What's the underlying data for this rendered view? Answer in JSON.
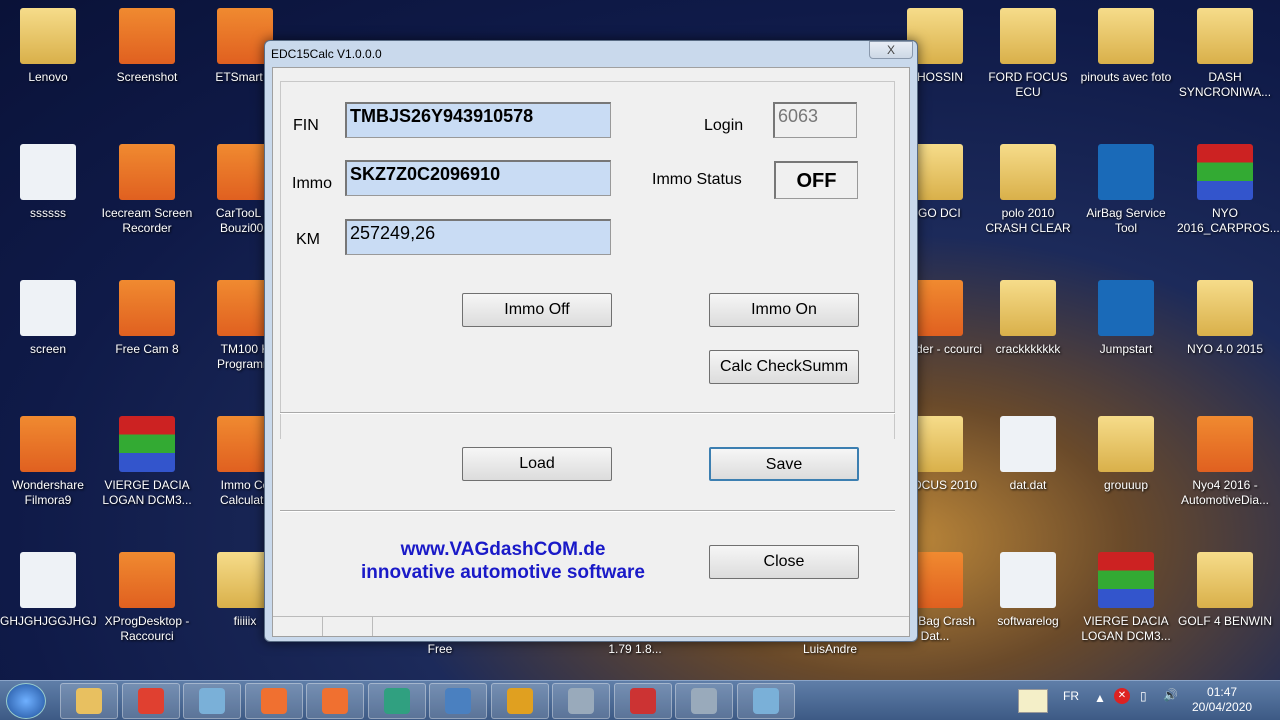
{
  "desktop": {
    "icons": [
      {
        "label": "Lenovo",
        "col": 0,
        "row": 0,
        "kind": "folder"
      },
      {
        "label": "ssssss",
        "col": 0,
        "row": 1,
        "kind": "file"
      },
      {
        "label": "screen",
        "col": 0,
        "row": 2,
        "kind": "file"
      },
      {
        "label": "Wondershare Filmora9",
        "col": 0,
        "row": 3,
        "kind": "app"
      },
      {
        "label": "GHJGHJGGJHGJ",
        "col": 0,
        "row": 4,
        "kind": "file"
      },
      {
        "label": "Screenshot",
        "col": 1,
        "row": 0,
        "kind": "app"
      },
      {
        "label": "Icecream Screen Recorder",
        "col": 1,
        "row": 1,
        "kind": "app"
      },
      {
        "label": "Free Cam 8",
        "col": 1,
        "row": 2,
        "kind": "app"
      },
      {
        "label": "VIERGE DACIA LOGAN DCM3...",
        "col": 1,
        "row": 3,
        "kind": "rar"
      },
      {
        "label": "XProgDesktop - Raccourci",
        "col": 1,
        "row": 4,
        "kind": "app"
      },
      {
        "label": "ETSmart U",
        "col": 2,
        "row": 0,
        "kind": "app"
      },
      {
        "label": "CarTooL 3. Bouzi002",
        "col": 2,
        "row": 1,
        "kind": "app"
      },
      {
        "label": "TM100 K Programm",
        "col": 2,
        "row": 2,
        "kind": "app"
      },
      {
        "label": "Immo Co Calculate",
        "col": 2,
        "row": 3,
        "kind": "app"
      },
      {
        "label": "fiiiiix",
        "col": 2,
        "row": 4,
        "kind": "folder"
      },
      {
        "label": "4 HOSSIN",
        "col": 3,
        "row": 0,
        "kind": "folder"
      },
      {
        "label": "NGO DCI",
        "col": 3,
        "row": 1,
        "kind": "folder"
      },
      {
        "label": "SLoader - ccourci",
        "col": 3,
        "row": 2,
        "kind": "app"
      },
      {
        "label": "D FOCUS 2010",
        "col": 3,
        "row": 3,
        "kind": "folder"
      },
      {
        "label": "s AirBag Crash Dat...",
        "col": 3,
        "row": 4,
        "kind": "app"
      },
      {
        "label": "FORD FOCUS ECU",
        "col": 4,
        "row": 0,
        "kind": "folder"
      },
      {
        "label": "polo 2010 CRASH CLEAR",
        "col": 4,
        "row": 1,
        "kind": "folder"
      },
      {
        "label": "crackkkkkkk",
        "col": 4,
        "row": 2,
        "kind": "folder"
      },
      {
        "label": "dat.dat",
        "col": 4,
        "row": 3,
        "kind": "file"
      },
      {
        "label": "softwarelog",
        "col": 4,
        "row": 4,
        "kind": "file"
      },
      {
        "label": "pinouts avec foto",
        "col": 5,
        "row": 0,
        "kind": "folder"
      },
      {
        "label": "AirBag Service Tool",
        "col": 5,
        "row": 1,
        "kind": "app"
      },
      {
        "label": "Jumpstart",
        "col": 5,
        "row": 2,
        "kind": "app"
      },
      {
        "label": "grouuup",
        "col": 5,
        "row": 3,
        "kind": "folder"
      },
      {
        "label": "VIERGE DACIA LOGAN DCM3...",
        "col": 5,
        "row": 4,
        "kind": "rar"
      },
      {
        "label": "DASH SYNCRONIWA...",
        "col": 6,
        "row": 0,
        "kind": "folder"
      },
      {
        "label": "NYO 2016_CARPROS...",
        "col": 6,
        "row": 1,
        "kind": "rar"
      },
      {
        "label": "NYO 4.0 2015",
        "col": 6,
        "row": 2,
        "kind": "folder"
      },
      {
        "label": "Nyo4 2016 - AutomotiveDia...",
        "col": 6,
        "row": 3,
        "kind": "app"
      },
      {
        "label": "GOLF 4 BENWIN",
        "col": 6,
        "row": 4,
        "kind": "folder"
      }
    ],
    "partial_labels": [
      "Free",
      "1.79 1.8...",
      "LuisAndre"
    ]
  },
  "window": {
    "title": "EDC15Calc V1.0.0.0",
    "close": "X",
    "fin_label": "FIN",
    "fin_value": "TMBJS26Y943910578",
    "immo_label": "Immo",
    "immo_value": "SKZ7Z0C2096910",
    "km_label": "KM",
    "km_value": "257249,26",
    "login_label": "Login",
    "login_value": "6063",
    "immo_status_label": "Immo Status",
    "immo_status_value": "OFF",
    "immo_off": "Immo Off",
    "immo_on": "Immo On",
    "calc": "Calc CheckSumm",
    "load": "Load",
    "save": "Save",
    "close_btn": "Close",
    "url": "www.VAGdashCOM.de",
    "tagline": "innovative automotive software"
  },
  "taskbar": {
    "apps": [
      "windows-explorer",
      "chrome",
      "notepad",
      "icecream-recorder",
      "screenshot",
      "filmora",
      "photo-viewer",
      "media-player",
      "calculator",
      "winrar",
      "calculator-2",
      "remote-desktop"
    ],
    "lang": "FR",
    "time": "01:47",
    "date": "20/04/2020"
  }
}
